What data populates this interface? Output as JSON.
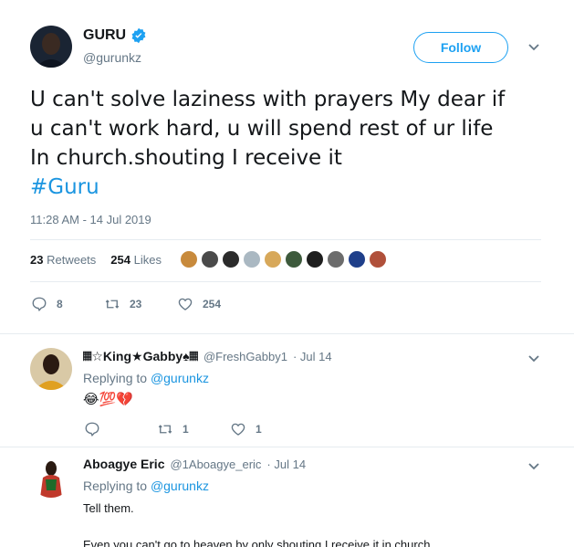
{
  "tweet": {
    "author_name": "GURU",
    "author_handle": "@gurunkz",
    "follow_label": "Follow",
    "text_lines": [
      "U can't solve laziness with prayers My dear if",
      "u can't work hard, u will spend rest of ur life",
      "In church.shouting I receive it"
    ],
    "hashtag": "#Guru",
    "timestamp": "11:28 AM - 14 Jul 2019",
    "retweets_count": "23",
    "retweets_label": "Retweets",
    "likes_count": "254",
    "likes_label": "Likes",
    "actions": {
      "reply_count": "8",
      "retweet_count": "23",
      "like_count": "254"
    }
  },
  "replies": [
    {
      "author_name": "𝄜☆King★Gabby♠𝄜",
      "author_handle": "@FreshGabby1",
      "date": "· Jul 14",
      "replying_prefix": "Replying to",
      "replying_to": "@gurunkz",
      "body": "😂💯💔",
      "retweet_count": "1",
      "like_count": "1"
    },
    {
      "author_name": "Aboagye Eric",
      "author_handle": "@1Aboagye_eric",
      "date": "· Jul 14",
      "replying_prefix": "Replying to",
      "replying_to": "@gurunkz",
      "body_line1": "Tell them.",
      "body_line2": "Even you can't go to heaven by only shouting I receive it in church"
    }
  ],
  "colors": {
    "brand": "#1da1f2",
    "link": "#1b95e0",
    "muted": "#657786",
    "divider": "#e6ecf0"
  }
}
